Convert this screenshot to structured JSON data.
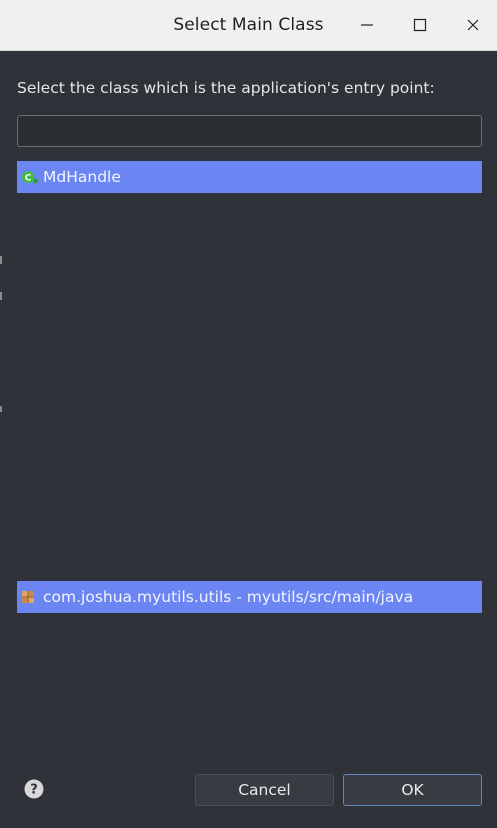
{
  "window": {
    "title": "Select Main Class"
  },
  "controls": {
    "minimize": "minimize",
    "maximize": "maximize",
    "close": "close"
  },
  "dialog": {
    "prompt": "Select the class which is the application's entry point:",
    "filter": {
      "value": "",
      "placeholder": ""
    },
    "classes": [
      {
        "label": "MdHandle",
        "icon": "class-main-icon",
        "selected": true
      }
    ],
    "packages": [
      {
        "label": "com.joshua.myutils.utils - myutils/src/main/java",
        "icon": "package-icon",
        "selected": true
      }
    ]
  },
  "footer": {
    "help_icon": "help-icon",
    "cancel_label": "Cancel",
    "ok_label": "OK"
  },
  "colors": {
    "background": "#2f3238",
    "selection": "#6b86f2",
    "titlebar": "#f0f0f0",
    "ok_border": "#5f87b9"
  }
}
